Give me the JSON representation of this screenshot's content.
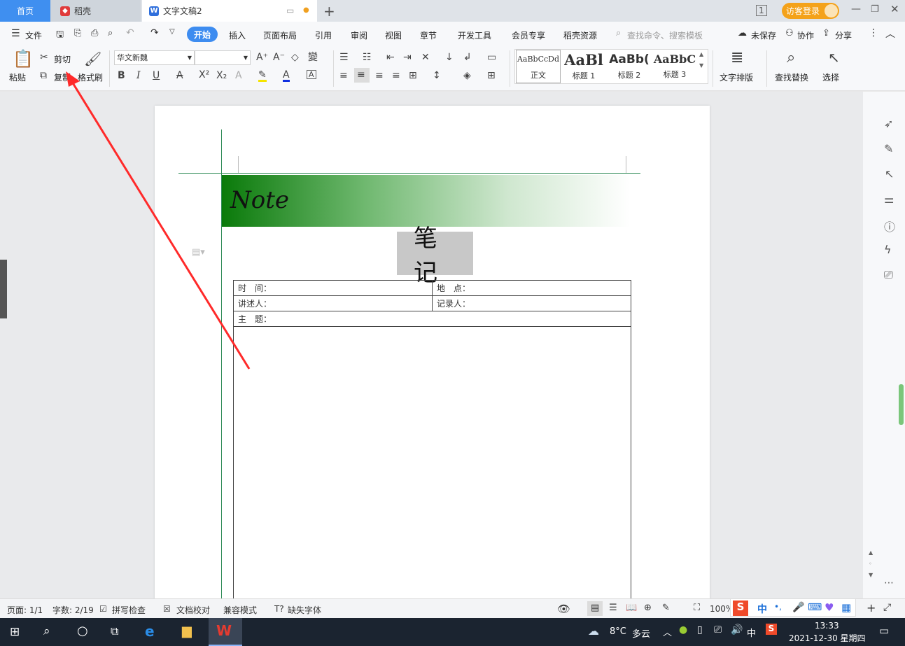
{
  "tabs": {
    "home": "首页",
    "daoke": "稻壳",
    "doc": "文字文稿2",
    "login": "访客登录"
  },
  "menu": {
    "file": "文件",
    "items": [
      "开始",
      "插入",
      "页面布局",
      "引用",
      "审阅",
      "视图",
      "章节",
      "开发工具",
      "会员专享",
      "稻壳资源"
    ],
    "search_placeholder": "查找命令、搜索模板",
    "unsaved": "未保存",
    "collab": "协作",
    "share": "分享"
  },
  "ribbon": {
    "paste": "粘贴",
    "cut": "剪切",
    "copy": "复制",
    "format_painter": "格式刷",
    "font_name": "华文新魏",
    "font_size": "",
    "styles": [
      {
        "preview": "AaBbCcDd",
        "label": "正文"
      },
      {
        "preview": "AaBl",
        "label": "标题 1"
      },
      {
        "preview": "AaBb(",
        "label": "标题 2"
      },
      {
        "preview": "AaBbC",
        "label": "标题 3"
      }
    ],
    "text_layout": "文字排版",
    "find_replace": "查找替换",
    "select": "选择"
  },
  "document": {
    "banner": "Note",
    "title": "笔记",
    "rows": [
      [
        "时　间：",
        "地　点："
      ],
      [
        "讲述人：",
        "记录人："
      ],
      [
        "主　题："
      ]
    ]
  },
  "status": {
    "page": "页面: 1/1",
    "words": "字数: 2/19",
    "spell": "拼写检查",
    "proof": "文档校对",
    "compat": "兼容模式",
    "missing_font": "缺失字体",
    "zoom": "100%"
  },
  "taskbar": {
    "weather_temp": "8°C",
    "weather_desc": "多云",
    "ime": "中",
    "time": "13:33",
    "date": "2021-12-30 星期四"
  },
  "colors": {
    "accent": "#3d8cf0",
    "arrow": "#ff2a2a",
    "banner_start": "#0a7a0a",
    "login": "#f4a21a"
  }
}
